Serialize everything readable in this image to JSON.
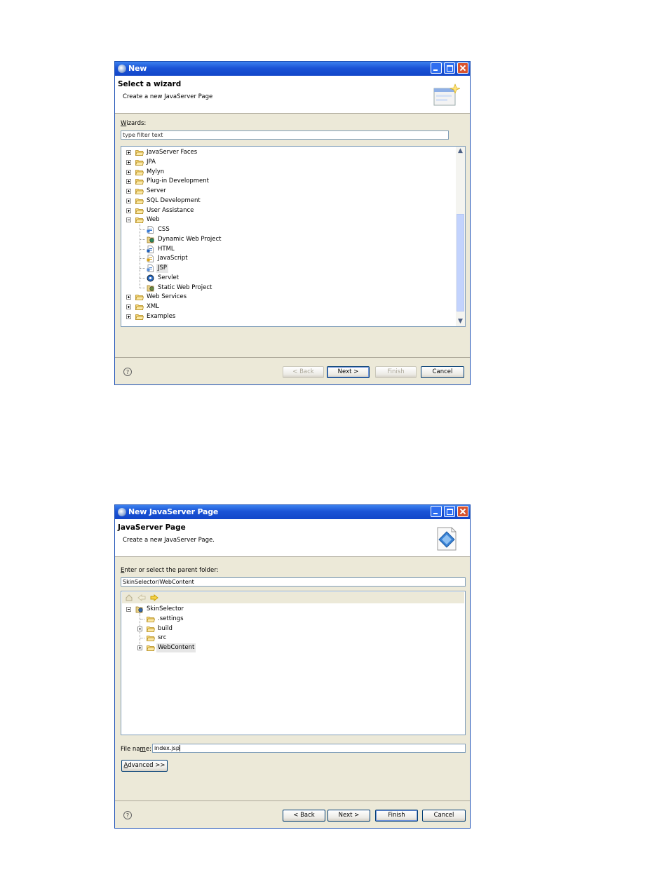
{
  "colors": {
    "title_bar": "#1a53d6",
    "dialog_bg": "#ece9d8",
    "selection": "#e6e6e6"
  },
  "window1": {
    "title": "New",
    "header_title": "Select a wizard",
    "header_subtitle": "Create a new JavaServer Page",
    "wizards_label": "Wizards:",
    "filter_placeholder": "type filter text",
    "tree": [
      {
        "label": "JavaServer Faces",
        "icon": "folder-icon",
        "expandable": true
      },
      {
        "label": "JPA",
        "icon": "folder-icon",
        "expandable": true
      },
      {
        "label": "Mylyn",
        "icon": "folder-icon",
        "expandable": true
      },
      {
        "label": "Plug-in Development",
        "icon": "folder-icon",
        "expandable": true
      },
      {
        "label": "Server",
        "icon": "folder-icon",
        "expandable": true
      },
      {
        "label": "SQL Development",
        "icon": "folder-icon",
        "expandable": true
      },
      {
        "label": "User Assistance",
        "icon": "folder-icon",
        "expandable": true
      },
      {
        "label": "Web",
        "icon": "folder-icon",
        "expanded": true
      },
      {
        "label": "CSS",
        "icon": "css-file-icon",
        "child": true
      },
      {
        "label": "Dynamic Web Project",
        "icon": "dynamic-web-project-icon",
        "child": true
      },
      {
        "label": "HTML",
        "icon": "html-file-icon",
        "child": true
      },
      {
        "label": "JavaScript",
        "icon": "javascript-file-icon",
        "child": true
      },
      {
        "label": "JSP",
        "icon": "jsp-file-icon",
        "child": true,
        "selected": true
      },
      {
        "label": "Servlet",
        "icon": "servlet-icon",
        "child": true
      },
      {
        "label": "Static Web Project",
        "icon": "static-web-project-icon",
        "child": true
      },
      {
        "label": "Web Services",
        "icon": "folder-icon",
        "expandable": true
      },
      {
        "label": "XML",
        "icon": "folder-icon",
        "expandable": true
      },
      {
        "label": "Examples",
        "icon": "folder-icon",
        "expandable": true
      }
    ],
    "buttons": {
      "back": "< Back",
      "next": "Next >",
      "finish": "Finish",
      "cancel": "Cancel"
    }
  },
  "window2": {
    "title": "New JavaServer Page",
    "header_title": "JavaServer Page",
    "header_subtitle": "Create a new JavaServer Page.",
    "parent_folder_label": "Enter or select the parent folder:",
    "parent_folder_value": "SkinSelector/WebContent",
    "tree": [
      {
        "label": "SkinSelector",
        "icon": "project-icon",
        "level": 0,
        "expanded": true
      },
      {
        "label": ".settings",
        "icon": "folder-icon",
        "level": 1
      },
      {
        "label": "build",
        "icon": "folder-icon",
        "level": 1,
        "expandable": true
      },
      {
        "label": "src",
        "icon": "folder-icon",
        "level": 1
      },
      {
        "label": "WebContent",
        "icon": "folder-icon",
        "level": 1,
        "expandable": true,
        "selected": true
      }
    ],
    "file_name_label": "File name:",
    "file_name_value": "index.jsp",
    "advanced_button": "Advanced >>",
    "buttons": {
      "back": "< Back",
      "next": "Next >",
      "finish": "Finish",
      "cancel": "Cancel"
    }
  }
}
